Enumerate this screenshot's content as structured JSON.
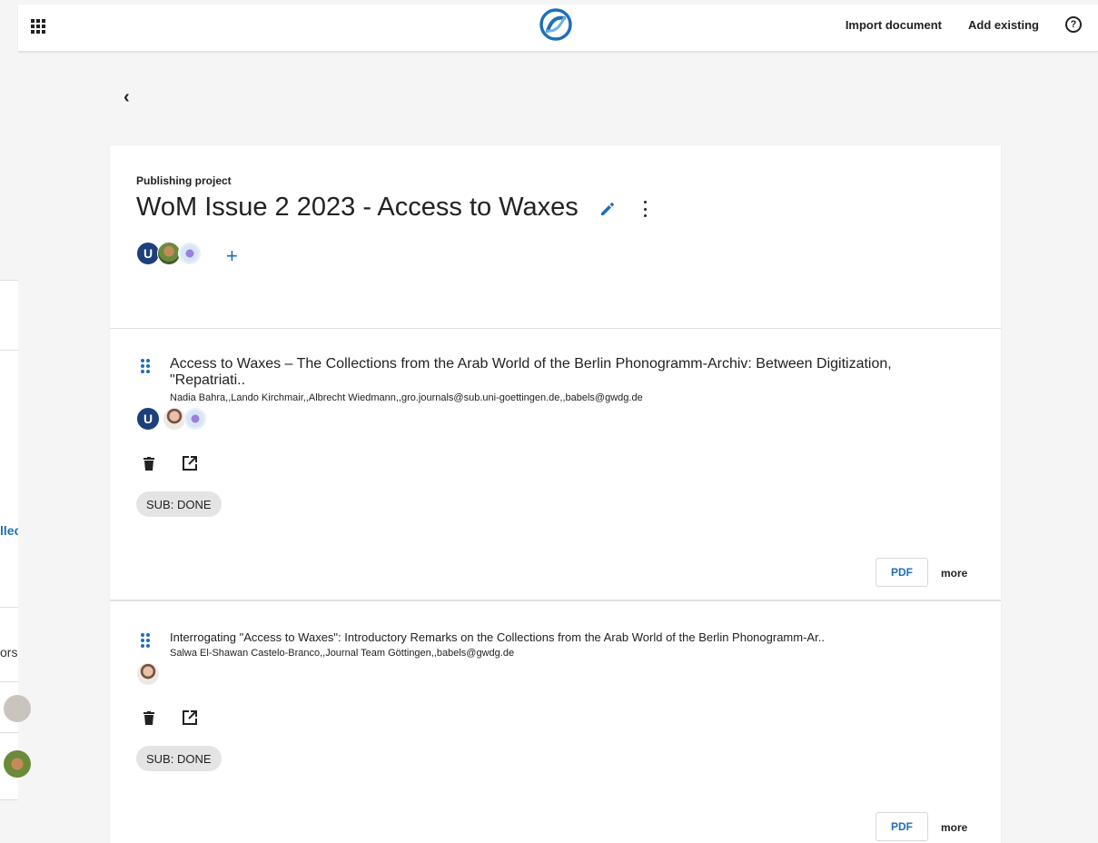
{
  "header": {
    "import_label": "Import document",
    "add_existing_label": "Add existing",
    "help_symbol": "?"
  },
  "background": {
    "link_fragment": "llec",
    "label_fragment": "ors"
  },
  "project": {
    "kicker": "Publishing project",
    "title": "WoM Issue 2 2023 - Access to Waxes",
    "members": [
      "SUB",
      "photo",
      "ai"
    ],
    "add_symbol": "+"
  },
  "chapters": [
    {
      "title": "Access to Waxes – The Collections from the Arab World of the Berlin Phonogramm-Archiv: Between Digitization, \"Repatriati..",
      "authors": "Nadia Bahra,,Lando Kirchmair,,Albrecht Wiedmann,,gro.journals@sub.uni-goettingen.de,,babels@gwdg.de",
      "status": "SUB: DONE",
      "pdf_label": "PDF",
      "more_label": "more"
    },
    {
      "title": "Interrogating \"Access to Waxes\": Introductory Remarks on the Collections from the Arab World of the Berlin Phonogramm-Ar..",
      "authors": "Salwa El-Shawan Castelo-Branco,,Journal Team Göttingen,,babels@gwdg.de",
      "status": "SUB: DONE",
      "pdf_label": "PDF",
      "more_label": "more"
    }
  ],
  "colors": {
    "accent": "#1d6fb8",
    "sub_avatar": "#1d3f7a",
    "chip_bg": "#e4e4e4"
  }
}
